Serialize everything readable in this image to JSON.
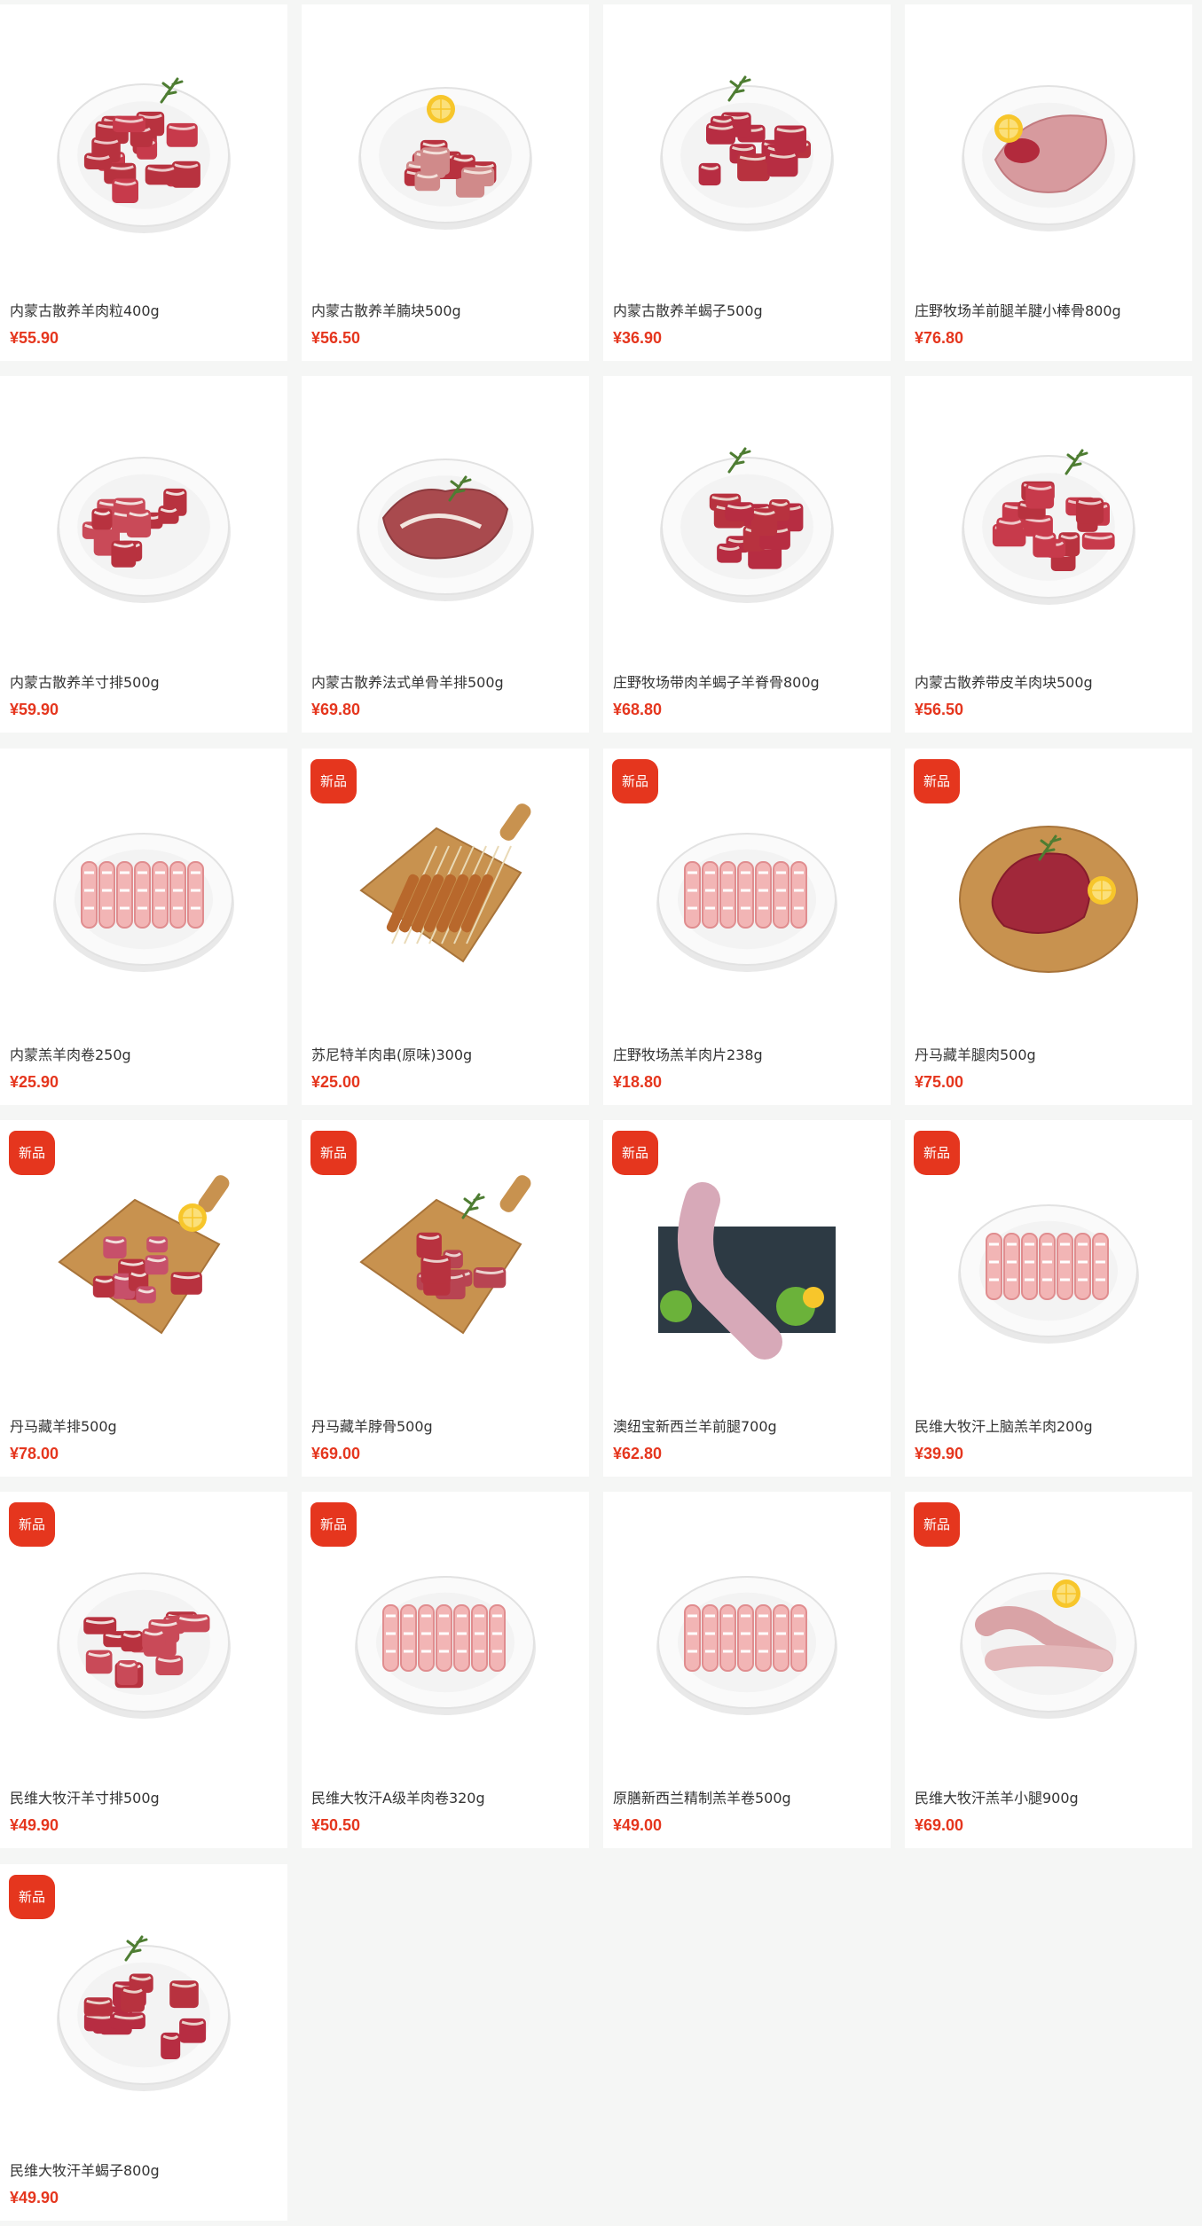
{
  "colors": {
    "page_background": "#f5f6f5",
    "card_background": "#ffffff",
    "price": "#e5361e",
    "badge": "#e5361e",
    "name": "#333333"
  },
  "products": [
    {
      "name": "内蒙古散养羊肉粒400g",
      "price": "¥55.90",
      "badge": "",
      "image": "plate-cubes-icon"
    },
    {
      "name": "内蒙古散养羊腩块500g",
      "price": "¥56.50",
      "badge": "",
      "image": "plate-belly-icon"
    },
    {
      "name": "内蒙古散养羊蝎子500g",
      "price": "¥36.90",
      "badge": "",
      "image": "plate-spine-icon"
    },
    {
      "name": "庄野牧场羊前腿羊腱小棒骨800g",
      "price": "¥76.80",
      "badge": "",
      "image": "plate-leg-icon"
    },
    {
      "name": "内蒙古散养羊寸排500g",
      "price": "¥59.90",
      "badge": "",
      "image": "plate-ribs-icon"
    },
    {
      "name": "内蒙古散养法式单骨羊排500g",
      "price": "¥69.80",
      "badge": "",
      "image": "plate-chops-icon"
    },
    {
      "name": "庄野牧场带肉羊蝎子羊脊骨800g",
      "price": "¥68.80",
      "badge": "",
      "image": "plate-spine-icon"
    },
    {
      "name": "内蒙古散养带皮羊肉块500g",
      "price": "¥56.50",
      "badge": "",
      "image": "plate-cubes-icon"
    },
    {
      "name": "内蒙羔羊肉卷250g",
      "price": "¥25.90",
      "badge": "",
      "image": "plate-rolls-icon"
    },
    {
      "name": "苏尼特羊肉串(原味)300g",
      "price": "¥25.00",
      "badge": "新品",
      "image": "board-skewers-icon"
    },
    {
      "name": "庄野牧场羔羊肉片238g",
      "price": "¥18.80",
      "badge": "新品",
      "image": "plate-rolls-icon"
    },
    {
      "name": "丹马藏羊腿肉500g",
      "price": "¥75.00",
      "badge": "新品",
      "image": "board-steak-icon"
    },
    {
      "name": "丹马藏羊排500g",
      "price": "¥78.00",
      "badge": "新品",
      "image": "board-ribs-icon"
    },
    {
      "name": "丹马藏羊脖骨500g",
      "price": "¥69.00",
      "badge": "新品",
      "image": "board-neck-icon"
    },
    {
      "name": "澳纽宝新西兰羊前腿700g",
      "price": "¥62.80",
      "badge": "新品",
      "image": "slate-leg-icon"
    },
    {
      "name": "民维大牧汗上脑羔羊肉200g",
      "price": "¥39.90",
      "badge": "新品",
      "image": "plate-rolls-icon"
    },
    {
      "name": "民维大牧汗羊寸排500g",
      "price": "¥49.90",
      "badge": "新品",
      "image": "plate-ribs-icon"
    },
    {
      "name": "民维大牧汗A级羊肉卷320g",
      "price": "¥50.50",
      "badge": "新品",
      "image": "plate-rolls-icon"
    },
    {
      "name": "原膳新西兰精制羔羊卷500g",
      "price": "¥49.00",
      "badge": "",
      "image": "plate-rolls-icon"
    },
    {
      "name": "民维大牧汗羔羊小腿900g",
      "price": "¥69.00",
      "badge": "新品",
      "image": "plate-shanks-icon"
    },
    {
      "name": "民维大牧汗羊蝎子800g",
      "price": "¥49.90",
      "badge": "新品",
      "image": "plate-spine-icon"
    }
  ]
}
